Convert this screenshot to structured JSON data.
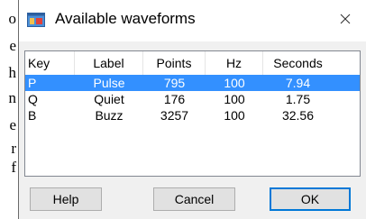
{
  "background_text": [
    "o",
    "e",
    "h",
    "n",
    "e",
    "r",
    "f"
  ],
  "dialog": {
    "title": "Available waveforms",
    "icon": "app-window-icon",
    "close_icon": "close-icon"
  },
  "list": {
    "columns": [
      "Key",
      "Label",
      "Points",
      "Hz",
      "Seconds"
    ],
    "rows": [
      {
        "key": "P",
        "label": "Pulse",
        "points": "795",
        "hz": "100",
        "seconds": "7.94",
        "selected": true
      },
      {
        "key": "Q",
        "label": "Quiet",
        "points": "176",
        "hz": "100",
        "seconds": "1.75",
        "selected": false
      },
      {
        "key": "B",
        "label": "Buzz",
        "points": "3257",
        "hz": "100",
        "seconds": "32.56",
        "selected": false
      }
    ],
    "selected_color": "#3390ff"
  },
  "buttons": {
    "help": "Help",
    "cancel": "Cancel",
    "ok": "OK"
  },
  "colors": {
    "accent": "#0078d7",
    "dialog_bg": "#f0f0f0"
  }
}
